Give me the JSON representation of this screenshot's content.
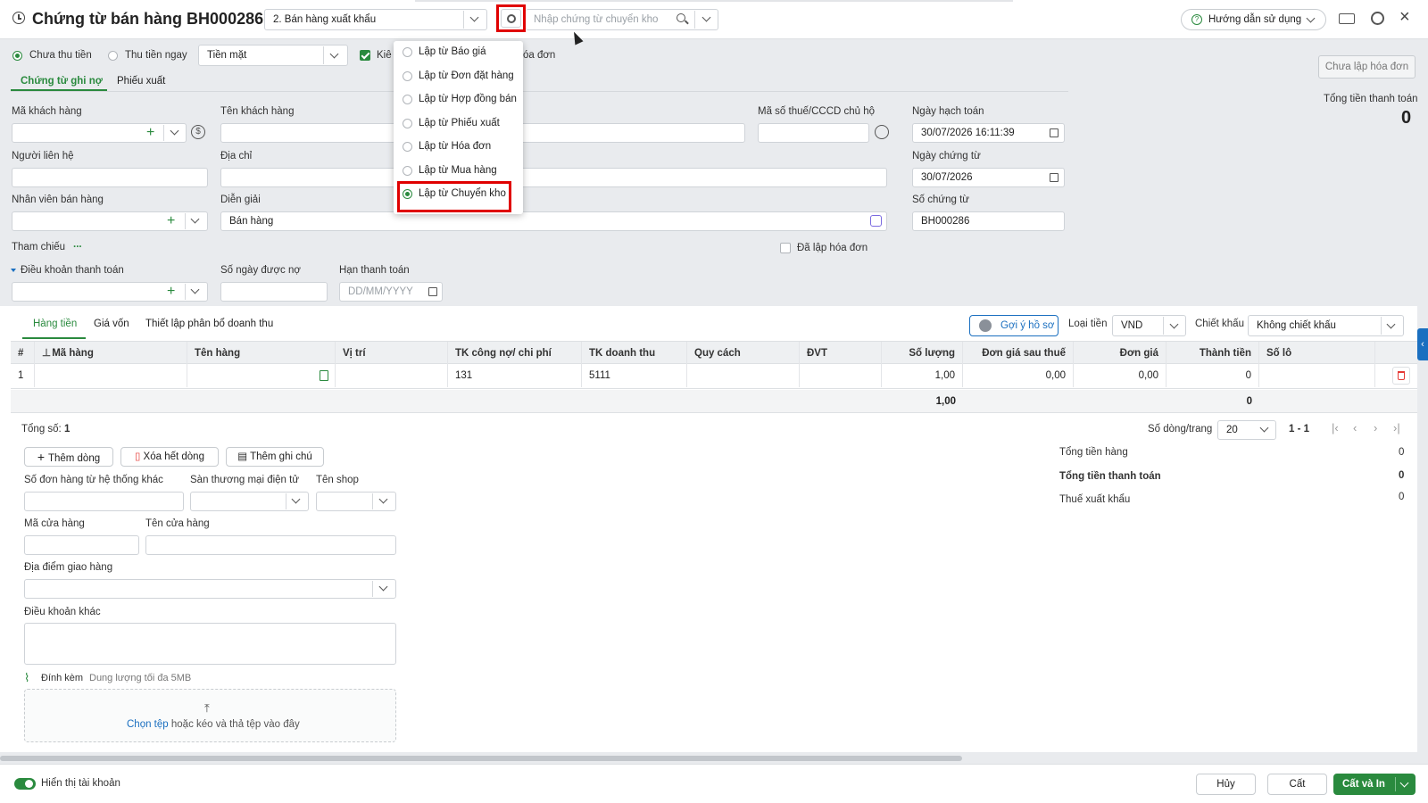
{
  "header": {
    "title": "Chứng từ bán hàng BH000286",
    "type_select": "2. Bán hàng xuất khẩu",
    "search_placeholder": "Nhập chứng từ chuyển kho",
    "help_label": "Hướng dẫn sử dụng"
  },
  "payment": {
    "option_unpaid": "Chưa thu tiền",
    "option_paid_now": "Thu tiền ngay",
    "method": "Tiền mặt",
    "check_label_partial": "Kiê",
    "check_label_tail": "óa đơn",
    "invoice_status_button": "Chưa lập hóa đơn"
  },
  "tabs": {
    "debit_voucher": "Chứng từ ghi nợ",
    "export_slip": "Phiếu xuất"
  },
  "totals_top": {
    "label": "Tổng tiền thanh toán",
    "value": "0"
  },
  "form": {
    "customer_code_label": "Mã khách hàng",
    "customer_name_label": "Tên khách hàng",
    "tax_id_label": "Mã số thuế/CCCD chủ hộ",
    "posting_date_label": "Ngày hạch toán",
    "posting_date": "30/07/2026 16:11:39",
    "contact_label": "Người liên hệ",
    "address_label": "Địa chỉ",
    "voucher_date_label": "Ngày chứng từ",
    "voucher_date": "30/07/2026",
    "salesperson_label": "Nhân viên bán hàng",
    "description_label": "Diễn giải",
    "description": "Bán hàng",
    "voucher_no_label": "Số chứng từ",
    "voucher_no": "BH000286",
    "reference_label": "Tham chiếu",
    "reference_link": "...",
    "invoiced_label": "Đã lập hóa đơn",
    "payment_terms_label": "Điều khoản thanh toán",
    "credit_days_label": "Số ngày được nợ",
    "due_date_label": "Hạn thanh toán",
    "due_date_placeholder": "DD/MM/YYYY"
  },
  "dropdown_menu": {
    "items": [
      {
        "label": "Lập từ Báo giá",
        "selected": false
      },
      {
        "label": "Lập từ Đơn đặt hàng",
        "selected": false
      },
      {
        "label": "Lập từ Hợp đồng bán",
        "selected": false
      },
      {
        "label": "Lập từ Phiếu xuất",
        "selected": false
      },
      {
        "label": "Lập từ Hóa đơn",
        "selected": false
      },
      {
        "label": "Lập từ Mua hàng",
        "selected": false
      },
      {
        "label": "Lập từ Chuyển kho",
        "selected": true
      }
    ],
    "highlight_color": "#e00000"
  },
  "detail_tabs": {
    "goods_money": "Hàng tiền",
    "cost": "Giá vốn",
    "revenue_allocation": "Thiết lập phân bổ doanh thu"
  },
  "detail_toolbar": {
    "suggest_label": "Gợi ý hồ sơ",
    "currency_label": "Loại tiền",
    "currency": "VND",
    "discount_label": "Chiết khấu",
    "discount": "Không chiết khấu"
  },
  "table": {
    "headers": [
      "#",
      "Mã hàng",
      "Tên hàng",
      "Vị trí",
      "TK công nợ/ chi phí",
      "TK doanh thu",
      "Quy cách",
      "ĐVT",
      "Số lượng",
      "Đơn giá sau thuế",
      "Đơn giá",
      "Thành tiền",
      "Số lô"
    ],
    "rows": [
      {
        "no": "1",
        "code": "",
        "name": "",
        "location": "",
        "debit_account": "131",
        "revenue_account": "5111",
        "spec": "",
        "unit": "",
        "qty": "1,00",
        "price_after_tax": "0,00",
        "price": "0,00",
        "amount": "0",
        "lot": ""
      }
    ],
    "footer": {
      "qty": "1,00",
      "amount": "0"
    }
  },
  "summary": {
    "total_label": "Tổng số:",
    "total_value": "1",
    "rows_per_page_label": "Số dòng/trang",
    "rows_per_page": "20",
    "page_range": "1 - 1",
    "goods_total_label": "Tổng tiền hàng",
    "goods_total": "0",
    "payment_total_label": "Tổng tiền thanh toán",
    "payment_total": "0",
    "export_tax_label": "Thuế xuất khẩu",
    "export_tax": "0"
  },
  "actions": {
    "add_row": "Thêm dòng",
    "delete_all": "Xóa hết dòng",
    "add_note": "Thêm ghi chú"
  },
  "extra": {
    "order_no_label": "Số đơn hàng từ hệ thống khác",
    "marketplace_label": "Sàn thương mại điện tử",
    "shop_name_label": "Tên shop",
    "store_code_label": "Mã cửa hàng",
    "store_name_label": "Tên cửa hàng",
    "delivery_label": "Địa điểm giao hàng",
    "other_terms_label": "Điều khoản khác",
    "attach_label": "Đính kèm",
    "attach_hint": "Dung lượng tối đa 5MB",
    "upload_link": "Chọn tệp",
    "upload_hint": "hoặc kéo và thả tệp vào đây"
  },
  "footer": {
    "show_accounts": "Hiển thị tài khoản",
    "cancel": "Hủy",
    "save": "Cất",
    "save_print": "Cất và In"
  },
  "colors": {
    "primary": "#2a8a3e",
    "highlight": "#e00000",
    "link": "#1a6fc0"
  }
}
